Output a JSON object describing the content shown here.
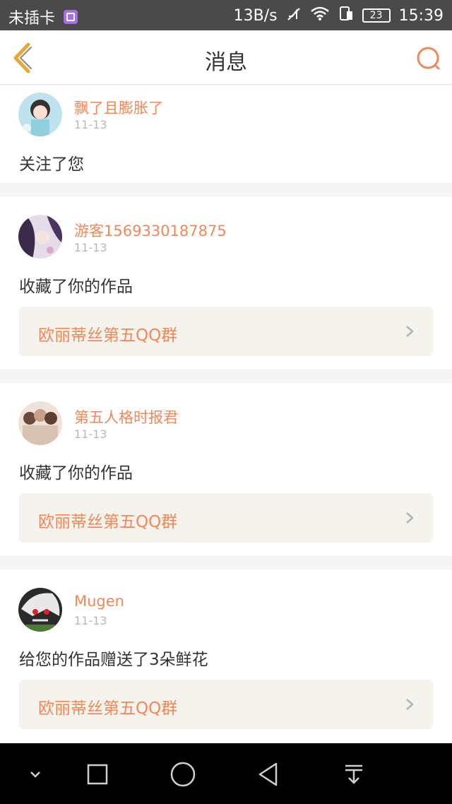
{
  "status_bar": {
    "carrier": "未插卡",
    "speed": "13B/s",
    "battery": "23",
    "time": "15:39"
  },
  "header": {
    "title": "消息"
  },
  "messages": [
    {
      "username": "飘了且膨胀了",
      "date": "11-13",
      "action": "关注了您"
    },
    {
      "username": "游客1569330187875",
      "date": "11-13",
      "action": "收藏了你的作品",
      "work": "欧丽蒂丝第五QQ群"
    },
    {
      "username": "第五人格时报君",
      "date": "11-13",
      "action": "收藏了你的作品",
      "work": "欧丽蒂丝第五QQ群"
    },
    {
      "username": "Mugen",
      "date": "11-13",
      "action": "给您的作品赠送了3朵鲜花",
      "work": "欧丽蒂丝第五QQ群"
    }
  ],
  "colors": {
    "accent": "#f0895a",
    "back_icon": "#e8a835"
  }
}
